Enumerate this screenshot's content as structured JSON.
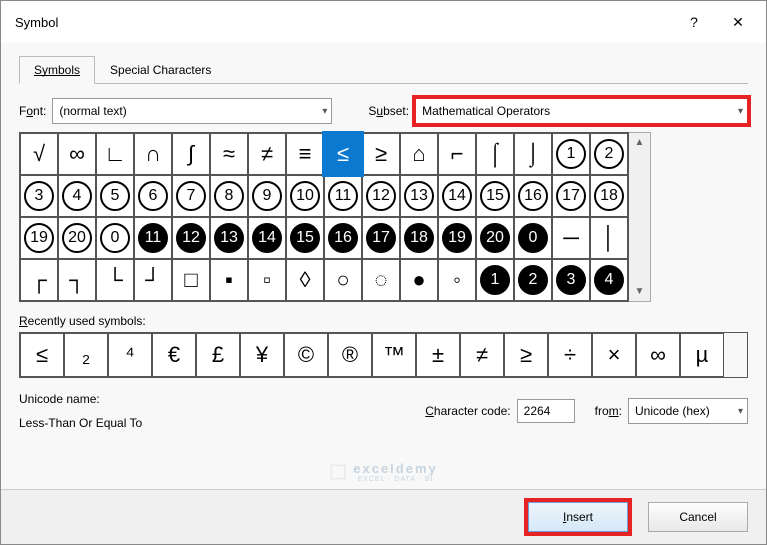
{
  "title": "Symbol",
  "tabs": {
    "symbols": "Symbols",
    "special": "Special Characters"
  },
  "font": {
    "label_pre": "F",
    "label_u": "o",
    "label_post": "nt:",
    "value": "(normal text)"
  },
  "subset": {
    "label_pre": "S",
    "label_u": "u",
    "label_post": "bset:",
    "value": "Mathematical Operators"
  },
  "grid": [
    [
      "√",
      "∞",
      "∟",
      "∩",
      "∫",
      "≈",
      "≠",
      "≡",
      "≤",
      "≥",
      "⌂",
      "⌐",
      "⌠",
      "⌡",
      "①",
      "②"
    ],
    [
      "③",
      "④",
      "⑤",
      "⑥",
      "⑦",
      "⑧",
      "⑨",
      "⑩",
      "⑪",
      "⑫",
      "⑬",
      "⑭",
      "⑮",
      "⑯",
      "⑰",
      "⑱"
    ],
    [
      "⑲",
      "⑳",
      "⓪",
      "⓫",
      "⓬",
      "⓭",
      "⓮",
      "⓯",
      "⓰",
      "⓱",
      "⓲",
      "⓳",
      "⓴",
      "⓿",
      "─",
      "│"
    ],
    [
      "┌",
      "┐",
      "└",
      "┘",
      "□",
      "▪",
      "▫",
      "◊",
      "○",
      "◌",
      "●",
      "◦",
      "❶",
      "❷",
      "❸",
      "❹"
    ]
  ],
  "selected": "≤",
  "recent_label_pre": "",
  "recent_label_u": "R",
  "recent_label_post": "ecently used symbols:",
  "recent": [
    "≤",
    "₂",
    "⁴",
    "€",
    "£",
    "¥",
    "©",
    "®",
    "™",
    "±",
    "≠",
    "≥",
    "÷",
    "×",
    "∞",
    "µ"
  ],
  "unicode_name_label": "Unicode name:",
  "unicode_name": "Less-Than Or Equal To",
  "char_code_pre": "",
  "char_code_u": "C",
  "char_code_post": "haracter code:",
  "char_code": "2264",
  "from_label_pre": "fro",
  "from_label_u": "m",
  "from_label_post": ":",
  "from_value": "Unicode (hex)",
  "insert_u": "I",
  "insert_post": "nsert",
  "cancel": "Cancel",
  "watermark": "exceldemy",
  "watermark_sub": "EXCEL · DATA · BI"
}
